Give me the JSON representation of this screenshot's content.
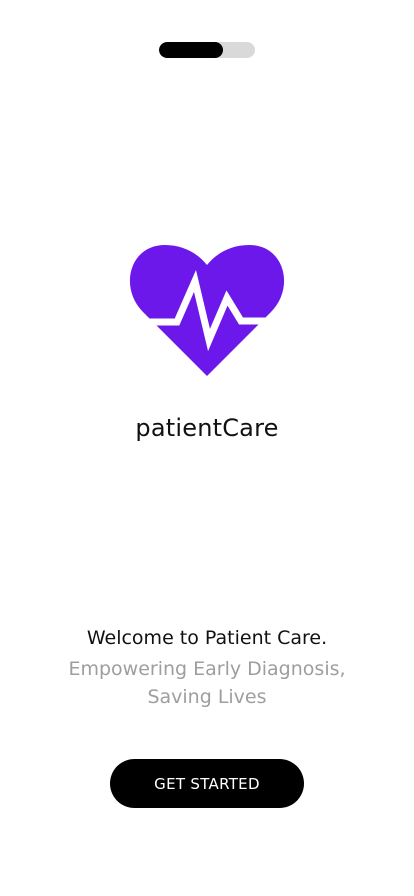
{
  "onboarding": {
    "progress": 0.67
  },
  "brand": {
    "name": "patientCare",
    "logo_icon": "heart-pulse-icon",
    "accent_color": "#6c18ea"
  },
  "welcome": {
    "title": "Welcome to Patient Care.",
    "tagline": "Empowering Early Diagnosis, Saving Lives"
  },
  "cta": {
    "label": "GET STARTED"
  }
}
